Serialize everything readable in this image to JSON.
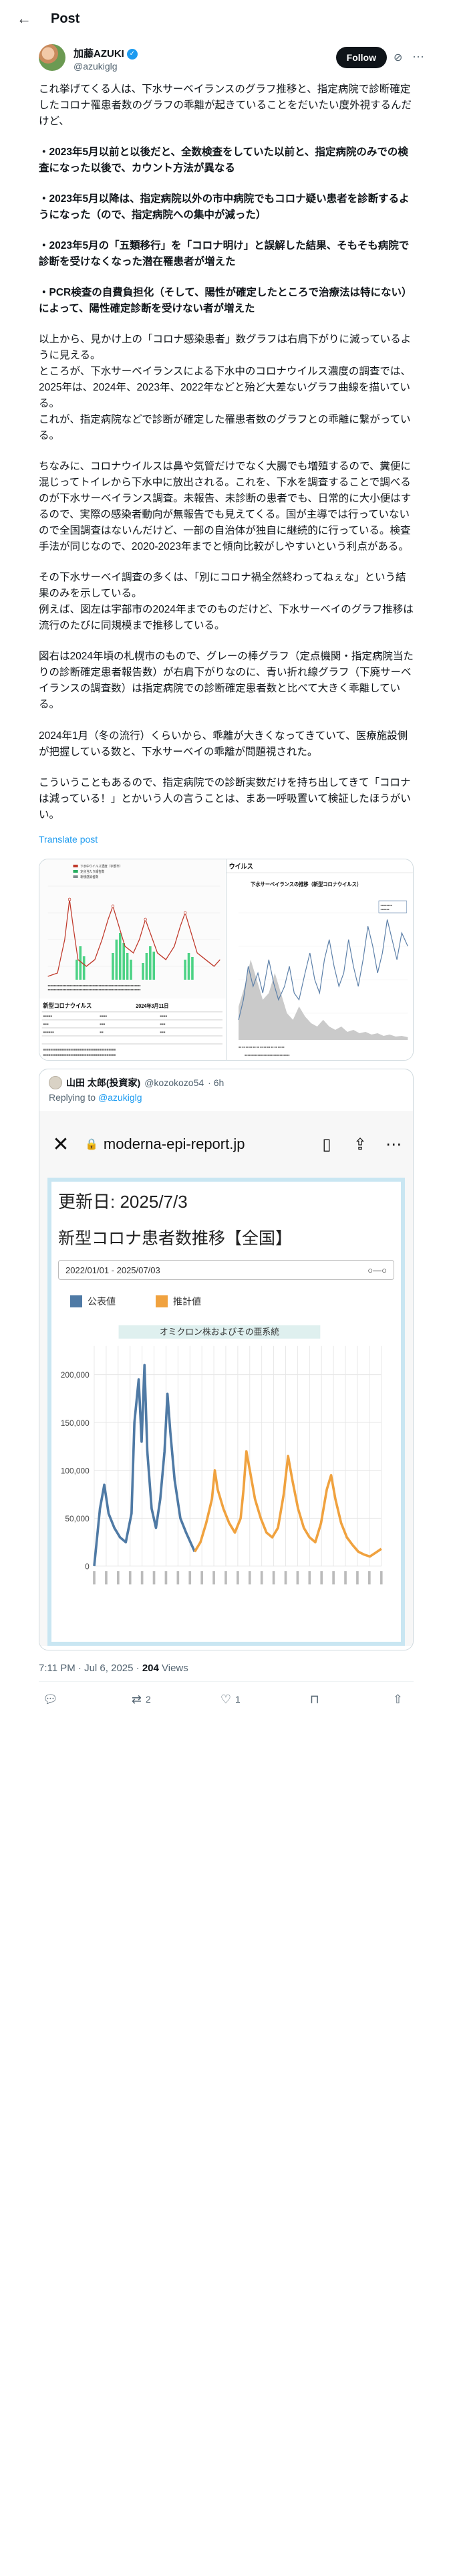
{
  "header": {
    "title": "Post",
    "back_icon": "arrow-left-icon"
  },
  "author": {
    "name": "加藤AZUKI",
    "handle": "@azukiglg",
    "follow_label": "Follow"
  },
  "tweet": {
    "p1": "これ挙げてくる人は、下水サーベイランスのグラフ推移と、指定病院で診断確定したコロナ罹患者数のグラフの乖離が起きていることをだいたい度外視するんだけど、",
    "p2": "・2023年5月以前と以後だと、全数検査をしていた以前と、指定病院のみでの検査になった以後で、カウント方法が異なる",
    "p3": "・2023年5月以降は、指定病院以外の市中病院でもコロナ疑い患者を診断するようになった（ので、指定病院への集中が減った）",
    "p4": "・2023年5月の「五類移行」を「コロナ明け」と誤解した結果、そもそも病院で診断を受けなくなった潜在罹患者が増えた",
    "p5": "・PCR検査の自費負担化（そして、陽性が確定したところで治療法は特にない）によって、陽性確定診断を受けない者が増えた",
    "p6a": "以上から、見かけ上の「コロナ感染患者」数グラフは右肩下がりに減っているように見える。",
    "p6b": "ところが、下水サーベイランスによる下水中のコロナウイルス濃度の調査では、2025年は、2024年、2023年、2022年などと殆ど大差ないグラフ曲線を描いている。",
    "p6c": "これが、指定病院などで診断が確定した罹患者数のグラフとの乖離に繋がっている。",
    "p7": "ちなみに、コロナウイルスは鼻や気管だけでなく大腸でも増殖するので、糞便に混じってトイレから下水中に放出される。これを、下水を調査することで調べるのが下水サーベイランス調査。未報告、未診断の患者でも、日常的に大小便はするので、実際の感染者動向が無報告でも見えてくる。国が主導では行っていないので全国調査はないんだけど、一部の自治体が独自に継続的に行っている。検査手法が同じなので、2020-2023年までと傾向比較がしやすいという利点がある。",
    "p8a": "その下水サーベイ調査の多くは、「別にコロナ禍全然終わってねぇな」という結果のみを示している。",
    "p8b": "例えば、図左は宇部市の2024年までのものだけど、下水サーベイのグラフ推移は流行のたびに同規模まで推移している。",
    "p9": "図右は2024年頃の札幌市のもので、グレーの棒グラフ（定点機関・指定病院当たりの診断確定患者報告数）が右肩下がりなのに、青い折れ線グラフ（下廃サーベイランスの調査数）は指定病院での診断確定患者数と比べて大きく乖離している。",
    "p10": "2024年1月（冬の流行）くらいから、乖離が大きくなってきていて、医療施設側が把握している数と、下水サーベイの乖離が問題視された。",
    "p11": "こういうこともあるので、指定病院での診断実数だけを持ち出してきて「コロナは減っている！」とかいう人の言うことは、まあ一呼吸置いて検証したほうがいい。",
    "translate": "Translate post"
  },
  "media_left": {
    "subtitle": "新型コロナウイルス",
    "date_label": "2024年3月11日",
    "legend": [
      "下水中ウイルス濃度（宇部市）",
      "定点当たり報告数",
      "新規感染者数"
    ]
  },
  "media_right": {
    "header": "ウイルス",
    "title": "下水サーベイランスの推移（新型コロナウイルス）"
  },
  "quote": {
    "name": "山田 太郎(投資家)",
    "handle": "@kozokozo54",
    "time": "· 6h",
    "reply_prefix": "Replying to ",
    "reply_handle": "@azukiglg",
    "browser": {
      "url": "moderna-epi-report.jp"
    },
    "report": {
      "updated": "更新日: 2025/7/3",
      "title": "新型コロナ患者数推移【全国】",
      "range": "2022/01/01 - 2025/07/03",
      "legend_public": "公表値",
      "legend_estimate": "推計値",
      "band_label": "オミクロン株およびその亜系統"
    }
  },
  "chart_data": {
    "type": "line",
    "title": "新型コロナ患者数推移【全国】",
    "ylim": [
      0,
      230000
    ],
    "yticks": [
      0,
      50000,
      100000,
      150000,
      200000
    ],
    "series": [
      {
        "name": "公表値",
        "color": "#4f7aa5",
        "points": [
          [
            0.0,
            0
          ],
          [
            0.02,
            60000
          ],
          [
            0.035,
            85000
          ],
          [
            0.05,
            55000
          ],
          [
            0.07,
            40000
          ],
          [
            0.09,
            30000
          ],
          [
            0.11,
            25000
          ],
          [
            0.13,
            55000
          ],
          [
            0.14,
            150000
          ],
          [
            0.155,
            195000
          ],
          [
            0.165,
            130000
          ],
          [
            0.175,
            210000
          ],
          [
            0.185,
            120000
          ],
          [
            0.2,
            60000
          ],
          [
            0.215,
            40000
          ],
          [
            0.23,
            70000
          ],
          [
            0.245,
            120000
          ],
          [
            0.255,
            180000
          ],
          [
            0.265,
            140000
          ],
          [
            0.28,
            90000
          ],
          [
            0.3,
            50000
          ],
          [
            0.32,
            35000
          ],
          [
            0.335,
            25000
          ],
          [
            0.35,
            15000
          ]
        ]
      },
      {
        "name": "推計値",
        "color": "#f0a23f",
        "points": [
          [
            0.35,
            15000
          ],
          [
            0.37,
            25000
          ],
          [
            0.39,
            45000
          ],
          [
            0.41,
            70000
          ],
          [
            0.42,
            100000
          ],
          [
            0.43,
            80000
          ],
          [
            0.45,
            60000
          ],
          [
            0.47,
            45000
          ],
          [
            0.49,
            35000
          ],
          [
            0.51,
            50000
          ],
          [
            0.52,
            80000
          ],
          [
            0.53,
            120000
          ],
          [
            0.545,
            95000
          ],
          [
            0.56,
            70000
          ],
          [
            0.58,
            50000
          ],
          [
            0.6,
            35000
          ],
          [
            0.62,
            30000
          ],
          [
            0.64,
            40000
          ],
          [
            0.66,
            75000
          ],
          [
            0.675,
            115000
          ],
          [
            0.69,
            90000
          ],
          [
            0.71,
            60000
          ],
          [
            0.73,
            40000
          ],
          [
            0.75,
            30000
          ],
          [
            0.77,
            25000
          ],
          [
            0.79,
            45000
          ],
          [
            0.81,
            80000
          ],
          [
            0.825,
            95000
          ],
          [
            0.84,
            70000
          ],
          [
            0.86,
            45000
          ],
          [
            0.88,
            30000
          ],
          [
            0.9,
            22000
          ],
          [
            0.92,
            15000
          ],
          [
            0.94,
            12000
          ],
          [
            0.96,
            10000
          ],
          [
            0.98,
            14000
          ],
          [
            1.0,
            18000
          ]
        ]
      }
    ]
  },
  "meta": {
    "time": "7:11 PM · Jul 6, 2025 · ",
    "views": "204",
    "views_label": " Views"
  },
  "actions": {
    "reply": "",
    "repost": "2",
    "like": "1",
    "bookmark": "",
    "share": ""
  }
}
